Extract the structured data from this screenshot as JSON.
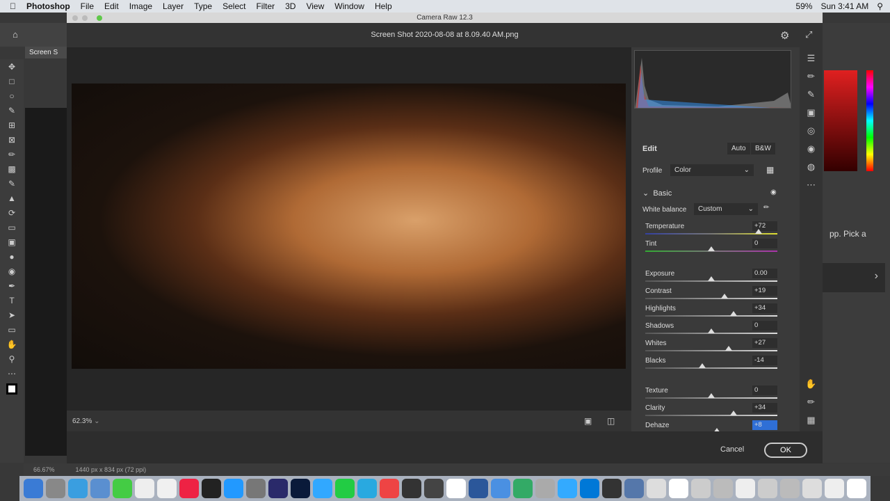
{
  "menubar": {
    "app": "Photoshop",
    "items": [
      "File",
      "Edit",
      "Image",
      "Layer",
      "Type",
      "Select",
      "Filter",
      "3D",
      "View",
      "Window",
      "Help"
    ],
    "battery": "59%",
    "clock": "Sun 3:41 AM"
  },
  "ps": {
    "tab": "Screen S",
    "zoom": "66.67%",
    "doc_info": "1440 px x 834 px (72 ppi)",
    "right_text": "pp. Pick a"
  },
  "camera_raw": {
    "window_title": "Camera Raw 12.3",
    "file_name": "Screen Shot 2020-08-08 at 8.09.40 AM.png",
    "zoom": "62.3%",
    "edit_title": "Edit",
    "auto": "Auto",
    "bw": "B&W",
    "profile_label": "Profile",
    "profile_value": "Color",
    "section": "Basic",
    "wb_label": "White balance",
    "wb_value": "Custom",
    "sliders": [
      {
        "label": "Temperature",
        "value": "+72",
        "pos": 0.86
      },
      {
        "label": "Tint",
        "value": "0",
        "pos": 0.5
      },
      {
        "label": "Exposure",
        "value": "0.00",
        "pos": 0.5
      },
      {
        "label": "Contrast",
        "value": "+19",
        "pos": 0.6
      },
      {
        "label": "Highlights",
        "value": "+34",
        "pos": 0.67
      },
      {
        "label": "Shadows",
        "value": "0",
        "pos": 0.5
      },
      {
        "label": "Whites",
        "value": "+27",
        "pos": 0.63
      },
      {
        "label": "Blacks",
        "value": "-14",
        "pos": 0.43
      },
      {
        "label": "Texture",
        "value": "0",
        "pos": 0.5
      },
      {
        "label": "Clarity",
        "value": "+34",
        "pos": 0.67
      },
      {
        "label": "Dehaze",
        "value": "+8",
        "pos": 0.54
      }
    ],
    "cancel": "Cancel",
    "ok": "OK"
  },
  "colors": {
    "accent": "#2f6fd6",
    "panel": "#3a3a3a"
  }
}
